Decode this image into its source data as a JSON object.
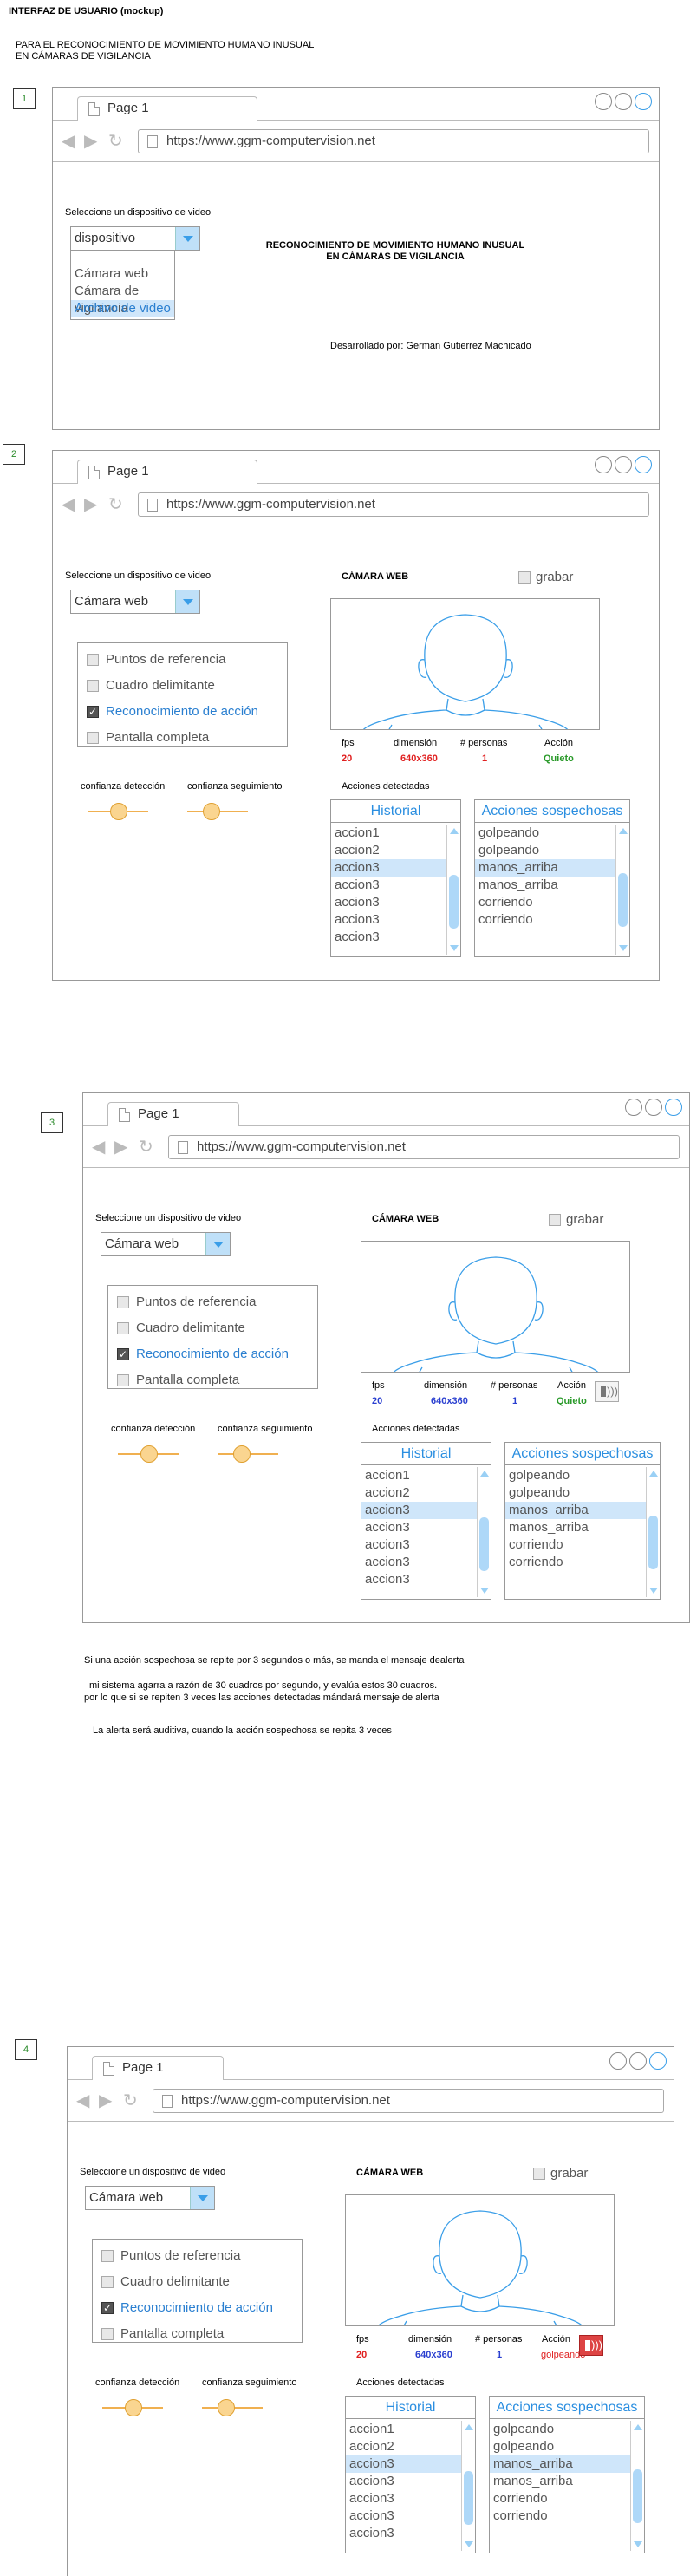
{
  "header": {
    "title": "INTERFAZ DE USUARIO  (mockup)",
    "subtitle_line1": "PARA EL RECONOCIMIENTO DE MOVIMIENTO  HUMANO INUSUAL",
    "subtitle_line2": "EN CÁMARAS DE VIGILANCIA"
  },
  "browser": {
    "tab_label": "Page 1",
    "url": "https://www.ggm-computervision.net"
  },
  "common": {
    "select_device_label": "Seleccione un dispositivo de video",
    "camera_title": "CÁMARA WEB",
    "record_label": "grabar",
    "options": [
      "Puntos de referencia",
      "Cuadro delimitante",
      "Reconocimiento de acción",
      "Pantalla completa"
    ],
    "confidence_detection": "confianza detección",
    "confidence_tracking": "confianza seguimiento",
    "stats_headers": {
      "fps": "fps",
      "dimension": "dimensión",
      "persons": "# personas",
      "action": "Acción"
    },
    "detected_actions_label": "Acciones detectadas",
    "history_header": "Historial",
    "suspicious_header": "Acciones sospechosas",
    "history_items": [
      "accion1",
      "accion2",
      "accion3",
      "accion3",
      "accion3",
      "accion3",
      "accion3"
    ],
    "suspicious_items": [
      "golpeando",
      "golpeando",
      "manos_arriba",
      "manos_arriba",
      "corriendo",
      "corriendo"
    ]
  },
  "step1": {
    "number": "1",
    "select_value": "dispositivo",
    "dropdown_options": [
      "Cámara web",
      "Cámara de vigilancia",
      "Archivo de video"
    ],
    "center_title_line1": "RECONOCIMIENTO DE MOVIMIENTO HUMANO INUSUAL",
    "center_title_line2": "EN CÁMARAS DE VIGILANCIA",
    "developer": "Desarrollado por: German Gutierrez Machicado"
  },
  "step2": {
    "number": "2",
    "select_value": "Cámara web",
    "stats": {
      "fps": "20",
      "dimension": "640x360",
      "persons": "1",
      "action": "Quieto"
    },
    "colors": {
      "fps": "#e02020",
      "dimension": "#e02020",
      "persons": "#e02020",
      "action": "#2a9a2a"
    }
  },
  "step3": {
    "number": "3",
    "select_value": "Cámara web",
    "stats": {
      "fps": "20",
      "dimension": "640x360",
      "persons": "1",
      "action": "Quieto"
    },
    "notes": [
      "Si una acción sospechosa se repite por 3 segundos o más, se manda el mensaje dealerta",
      "mi sistema agarra a razón de 30 cuadros por segundo, y evalúa estos 30 cuadros.",
      "por lo que si se repiten 3 veces las acciones detectadas mándará mensaje de alerta",
      "La alerta será auditiva, cuando la acción sospechosa se repita 3 veces"
    ]
  },
  "step4": {
    "number": "4",
    "select_value": "Cámara web",
    "stats": {
      "fps": "20",
      "dimension": "640x360",
      "persons": "1",
      "action": "golpeando"
    }
  }
}
